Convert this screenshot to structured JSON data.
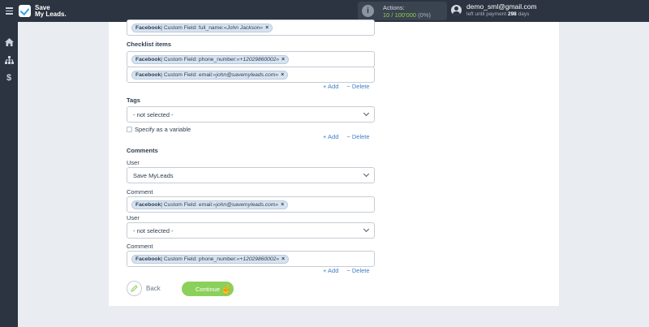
{
  "header": {
    "logo_line1": "Save",
    "logo_line2": "My Leads.",
    "actions_label": "Actions:",
    "actions_count": "10 / 100'000",
    "actions_pct": "(0%)",
    "user_email": "demo_sml@gmail.com",
    "payment_prefix": "left until payment ",
    "payment_days": "298",
    "payment_suffix": " days"
  },
  "sidebar": {
    "icons": [
      "home-icon",
      "sitemap-icon",
      "dollar-icon"
    ]
  },
  "form": {
    "top_tag": {
      "source": "Facebook",
      "text": " | Custom Field: full_name: ",
      "value": "«John Jackson»"
    },
    "checklist_label": "Checklist items",
    "checklist_tags": [
      {
        "source": "Facebook",
        "text": " | Custom Field: phone_number: ",
        "value": "«+12029860002»"
      },
      {
        "source": "Facebook",
        "text": " | Custom Field: email: ",
        "value": "«john@savemyleads.com»"
      }
    ],
    "add_label": "+ Add",
    "delete_label": "− Delete",
    "tags_label": "Tags",
    "tags_select": "- not selected -",
    "specify_variable": "Specify as a variable",
    "comments_label": "Comments",
    "user_label": "User",
    "user1_select": "Save MyLeads",
    "comment_label": "Comment",
    "comment1_tag": {
      "source": "Facebook",
      "text": " | Custom Field: email: ",
      "value": "«john@savemyleads.com»"
    },
    "user2_select": "- not selected -",
    "comment2_tag": {
      "source": "Facebook",
      "text": " | Custom Field: phone_number: ",
      "value": "«+12029860002»"
    },
    "back_label": "Back",
    "continue_label": "Continue"
  },
  "colors": {
    "topbar": "#2b3440",
    "continue_green": "#8bd05a",
    "link_blue": "#3f7fc6",
    "tag_bg": "#d8e3f0"
  }
}
